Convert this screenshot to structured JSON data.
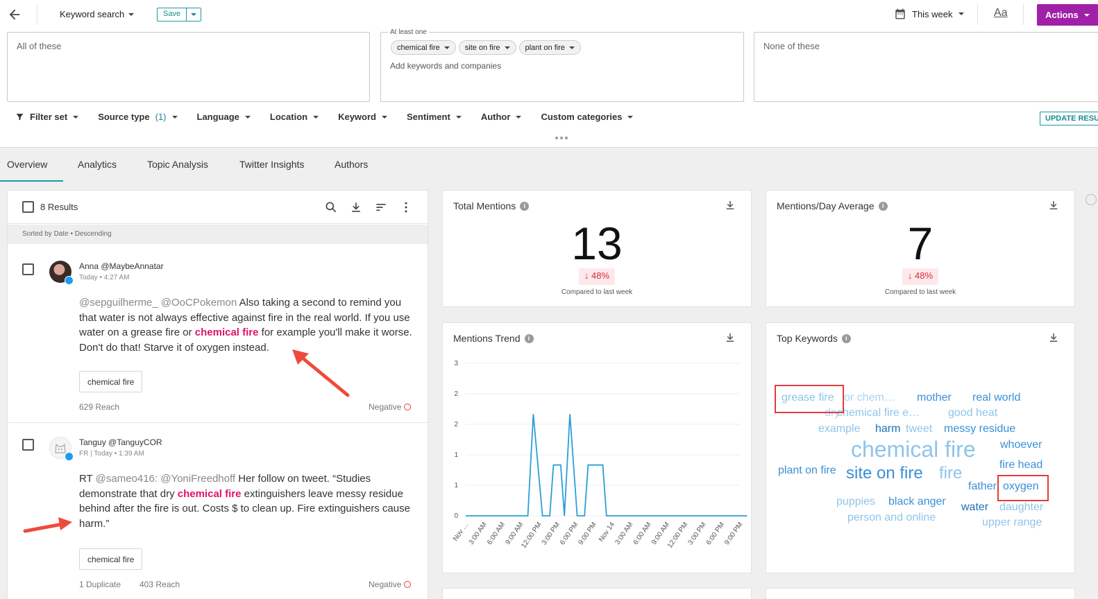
{
  "header": {
    "title": "Keyword search",
    "save_label": "Save",
    "date_range": "This week",
    "font_toggle": "Aa",
    "actions_label": "Actions"
  },
  "query": {
    "all_placeholder": "All of these",
    "at_least_label": "At least one",
    "chips": [
      "chemical fire",
      "site on fire",
      "plant on fire"
    ],
    "add_placeholder": "Add keywords and companies",
    "none_placeholder": "None of these"
  },
  "filters": {
    "filter_set": "Filter set",
    "source_type": "Source type",
    "source_count": "(1)",
    "language": "Language",
    "location": "Location",
    "keyword": "Keyword",
    "sentiment": "Sentiment",
    "author": "Author",
    "custom_categories": "Custom categories",
    "update_label": "UPDATE RESULTS"
  },
  "tabs": [
    "Overview",
    "Analytics",
    "Topic Analysis",
    "Twitter Insights",
    "Authors"
  ],
  "results": {
    "count": "8 Results",
    "sorted": "Sorted by Date • Descending",
    "posts": [
      {
        "author": "Anna @MaybeAnnatar",
        "meta": "Today • 4:27 AM",
        "mention": "@sepguilherme_ @OoCPokemon",
        "text_a": " Also taking a second to remind you that water is not always effective against fire in the real world. If you use water on a grease fire or ",
        "keyword": "chemical fire",
        "text_b": " for example you'll make it worse. Don't do that! Starve it of oxygen instead.",
        "tag": "chemical fire",
        "reach": "629 Reach",
        "sentiment": "Negative"
      },
      {
        "author": "Tanguy @TanguyCOR",
        "meta": "FR |  Today • 1:39 AM",
        "text_pre": "RT ",
        "mention": "@sameo416: @YoniFreedhoff",
        "text_a": " Her follow on tweet. “Studies demonstrate that dry ",
        "keyword": "chemical fire",
        "text_b": " extinguishers leave messy residue behind after the fire is out. Costs $ to clean up. Fire extinguishers cause harm.”",
        "tag": "chemical fire",
        "duplicate": "1 Duplicate",
        "reach": "403 Reach",
        "sentiment": "Negative"
      }
    ]
  },
  "total_mentions": {
    "title": "Total Mentions",
    "value": "13",
    "change": "48%",
    "compare": "Compared to last week"
  },
  "mentions_avg": {
    "title": "Mentions/Day Average",
    "value": "7",
    "change": "48%",
    "compare": "Compared to last week"
  },
  "trend": {
    "title": "Mentions Trend"
  },
  "top_keywords": {
    "title": "Top Keywords",
    "words": [
      {
        "text": "grease fire",
        "color": "#8ec5ea",
        "size": 16
      },
      {
        "text": "or chem…",
        "color": "#a9d3f0",
        "size": 16
      },
      {
        "text": "mother",
        "color": "#3a8fd6",
        "size": 16
      },
      {
        "text": "real world",
        "color": "#3a8fd6",
        "size": 16
      },
      {
        "text": "dry",
        "color": "#a9d3f0",
        "size": 16
      },
      {
        "text": "chemical fire e…",
        "color": "#8ec5ea",
        "size": 16
      },
      {
        "text": "good heat",
        "color": "#8ec5ea",
        "size": 16
      },
      {
        "text": "example",
        "color": "#8ec5ea",
        "size": 16
      },
      {
        "text": "harm",
        "color": "#1d6fb8",
        "size": 16
      },
      {
        "text": "tweet",
        "color": "#8ec5ea",
        "size": 16
      },
      {
        "text": "messy residue",
        "color": "#3a8fd6",
        "size": 16
      },
      {
        "text": "whoever",
        "color": "#3a8fd6",
        "size": 16
      },
      {
        "text": "chemical fire",
        "color": "#8ec5ea",
        "size": 32
      },
      {
        "text": "fire head",
        "color": "#3a8fd6",
        "size": 16
      },
      {
        "text": "plant on fire",
        "color": "#3a8fd6",
        "size": 16
      },
      {
        "text": "site on fire",
        "color": "#3a8fd6",
        "size": 24
      },
      {
        "text": "fire",
        "color": "#8ec5ea",
        "size": 24
      },
      {
        "text": "father",
        "color": "#3a8fd6",
        "size": 16
      },
      {
        "text": "oxygen",
        "color": "#3a8fd6",
        "size": 16
      },
      {
        "text": "puppies",
        "color": "#8ec5ea",
        "size": 16
      },
      {
        "text": "black anger",
        "color": "#3a8fd6",
        "size": 16
      },
      {
        "text": "water",
        "color": "#1d6fb8",
        "size": 16
      },
      {
        "text": "daughter",
        "color": "#8ec5ea",
        "size": 16
      },
      {
        "text": "person and online",
        "color": "#8ec5ea",
        "size": 16
      },
      {
        "text": "upper range",
        "color": "#8ec5ea",
        "size": 16
      }
    ]
  },
  "chart_data": {
    "type": "line",
    "title": "Mentions Trend",
    "x": [
      "Nov …",
      "3:00 AM",
      "6:00 AM",
      "9:00 AM",
      "12:00 PM",
      "3:00 PM",
      "6:00 PM",
      "9:00 PM",
      "Nov 14",
      "3:00 AM",
      "6:00 AM",
      "9:00 AM",
      "12:00 PM",
      "3:00 PM",
      "6:00 PM",
      "9:00 PM"
    ],
    "y_ticks": [
      0,
      1,
      1,
      2,
      2,
      3
    ],
    "ylim": [
      0,
      3
    ],
    "grid": true,
    "color": "#2a9fd8",
    "points": [
      [
        0,
        0
      ],
      [
        1,
        0
      ],
      [
        2,
        0
      ],
      [
        3,
        0
      ],
      [
        3.4,
        0
      ],
      [
        3.7,
        2
      ],
      [
        4.2,
        0
      ],
      [
        4.6,
        0
      ],
      [
        4.8,
        1
      ],
      [
        5.2,
        1
      ],
      [
        5.4,
        0
      ],
      [
        5.7,
        2
      ],
      [
        6.1,
        0
      ],
      [
        6.5,
        0
      ],
      [
        6.7,
        1
      ],
      [
        7.5,
        1
      ],
      [
        7.7,
        0
      ],
      [
        8,
        0
      ],
      [
        9,
        0
      ],
      [
        10,
        0
      ],
      [
        11,
        0
      ],
      [
        12,
        0
      ],
      [
        13,
        0
      ],
      [
        14,
        0
      ],
      [
        15,
        0
      ],
      [
        15.4,
        0
      ]
    ]
  }
}
